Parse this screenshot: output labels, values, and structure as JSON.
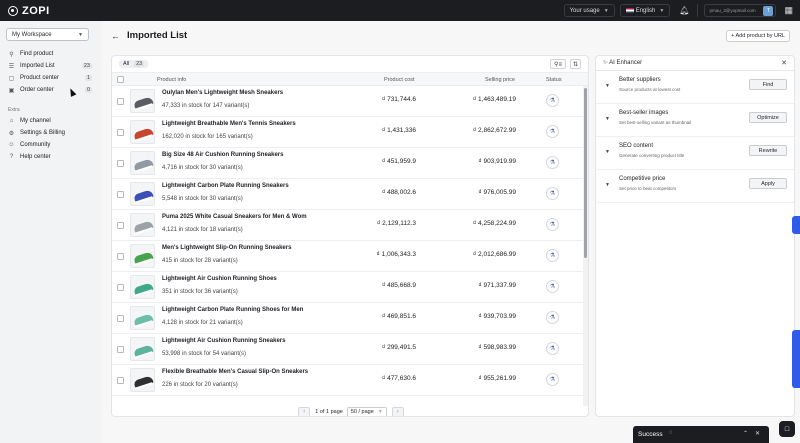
{
  "topbar": {
    "logo": "ZOPI",
    "usage_label": "Your usage",
    "language_label": "English",
    "email": "pmau_3@yopmail.com",
    "avatar_initial": "T"
  },
  "sidebar": {
    "workspace": "My Workspace",
    "items": [
      {
        "label": "Find product",
        "icon": "search-icon",
        "badge": ""
      },
      {
        "label": "Imported List",
        "icon": "list-icon",
        "badge": "23"
      },
      {
        "label": "Product center",
        "icon": "box-icon",
        "badge": "1"
      },
      {
        "label": "Order center",
        "icon": "cart-icon",
        "badge": "0"
      }
    ],
    "extra_heading": "Extra",
    "extra_items": [
      {
        "label": "My channel",
        "icon": "channel-icon"
      },
      {
        "label": "Settings & Billing",
        "icon": "gear-icon"
      },
      {
        "label": "Community",
        "icon": "community-icon"
      },
      {
        "label": "Help center",
        "icon": "help-icon"
      }
    ]
  },
  "page": {
    "title": "Imported List",
    "add_button": "Add product by URL"
  },
  "table": {
    "tab_all": "All",
    "tab_count": "23",
    "columns": {
      "product_info": "Product info",
      "product_cost": "Product cost",
      "selling_price": "Selling price",
      "status": "Status"
    },
    "rows": [
      {
        "name": "Oulylan Men's Lightweight Mesh Sneakers",
        "stock": "47,333 in stock for 147 variant(s)",
        "cost": "₫ 731,744.6",
        "price": "₫ 1,463,489.19",
        "color": "#5b5d62"
      },
      {
        "name": "Lightweight Breathable Men's Tennis Sneakers",
        "stock": "162,020 in stock for 165 variant(s)",
        "cost": "₫ 1,431,336",
        "price": "₫ 2,862,672.99",
        "color": "#c8462f"
      },
      {
        "name": "Big Size 48 Air Cushion Running Sneakers",
        "stock": "4,716 in stock for 30 variant(s)",
        "cost": "₫ 451,959.9",
        "price": "₫ 903,919.99",
        "color": "#8f9aa6"
      },
      {
        "name": "Lightweight Carbon Plate Running Sneakers",
        "stock": "5,548 in stock for 30 variant(s)",
        "cost": "₫ 488,002.6",
        "price": "₫ 976,005.99",
        "color": "#3d4fb8"
      },
      {
        "name": "Puma 2025 White Casual Sneakers for Men & Wom",
        "stock": "4,121 in stock for 18 variant(s)",
        "cost": "₫ 2,129,112.3",
        "price": "₫ 4,258,224.99",
        "color": "#9da2a8"
      },
      {
        "name": "Men's Lightweight Slip-On Running Sneakers",
        "stock": "415 in stock for 28 variant(s)",
        "cost": "₫ 1,006,343.3",
        "price": "₫ 2,012,686.99",
        "color": "#48a34f"
      },
      {
        "name": "Lightweight Air Cushion Running Shoes",
        "stock": "351 in stock for 36 variant(s)",
        "cost": "₫ 485,668.9",
        "price": "₫ 971,337.99",
        "color": "#3fa889"
      },
      {
        "name": "Lightweight Carbon Plate Running Shoes for Men",
        "stock": "4,128 in stock for 21 variant(s)",
        "cost": "₫ 469,851.6",
        "price": "₫ 939,703.99",
        "color": "#6bbfa8"
      },
      {
        "name": "Lightweight Air Cushion Running Sneakers",
        "stock": "53,998 in stock for 54 variant(s)",
        "cost": "₫ 299,491.5",
        "price": "₫ 598,983.99",
        "color": "#5fb39c"
      },
      {
        "name": "Flexible Breathable Men's Casual Slip-On Sneakers",
        "stock": "226 in stock for 20 variant(s)",
        "cost": "₫ 477,630.6",
        "price": "₫ 955,261.99",
        "color": "#2f3033"
      }
    ]
  },
  "pagination": {
    "info": "1 of 1 page",
    "page_size": "50 / page"
  },
  "ai": {
    "title": "AI Enhancer",
    "items": [
      {
        "title": "Better suppliers",
        "desc": "Source products at lowest cost",
        "button": "Find"
      },
      {
        "title": "Best-seller images",
        "desc": "Set best-selling variant as thumbnail",
        "button": "Optimize"
      },
      {
        "title": "SEO content",
        "desc": "Generate converting product title",
        "button": "Rewrite"
      },
      {
        "title": "Competitive price",
        "desc": "Set price to beat competitors",
        "button": "Apply"
      }
    ]
  },
  "toast": {
    "message": "Success"
  },
  "colors": {
    "topbar": "#1c1d20",
    "accent": "#2f5be8",
    "status_icon": "#4a5fc1"
  }
}
